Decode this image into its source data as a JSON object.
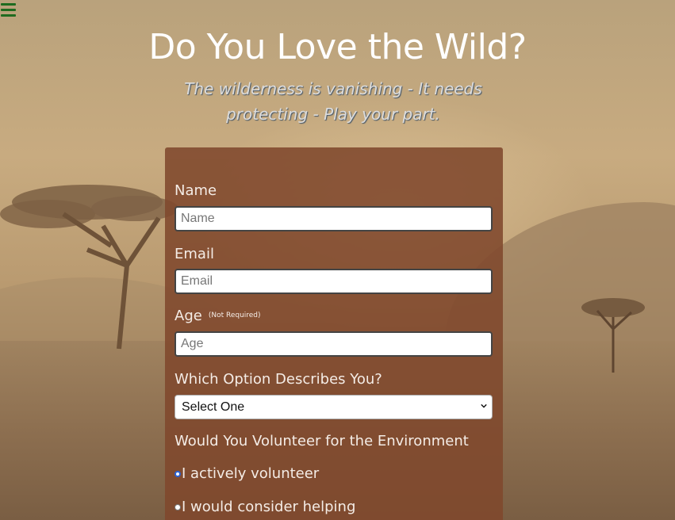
{
  "header": {
    "menu_icon": "hamburger-icon",
    "title": "Do You Love the Wild?",
    "subtitle": "The wilderness is vanishing - It needs protecting - Play your part."
  },
  "form": {
    "name_label": "Name",
    "name_placeholder": "Name",
    "email_label": "Email",
    "email_placeholder": "Email",
    "age_label": "Age",
    "age_note": "(Not Required)",
    "age_placeholder": "Age",
    "option_label": "Which Option Describes You?",
    "option_selected": "Select One",
    "volunteer_label": "Would You Volunteer for the Environment",
    "radio_options": [
      {
        "label": "I actively volunteer",
        "checked": true
      },
      {
        "label": "I would consider helping",
        "checked": false
      }
    ]
  },
  "colors": {
    "panel": "#80482c",
    "menu_icon": "#1f6b1f",
    "radio_accent": "#2a62d6"
  }
}
